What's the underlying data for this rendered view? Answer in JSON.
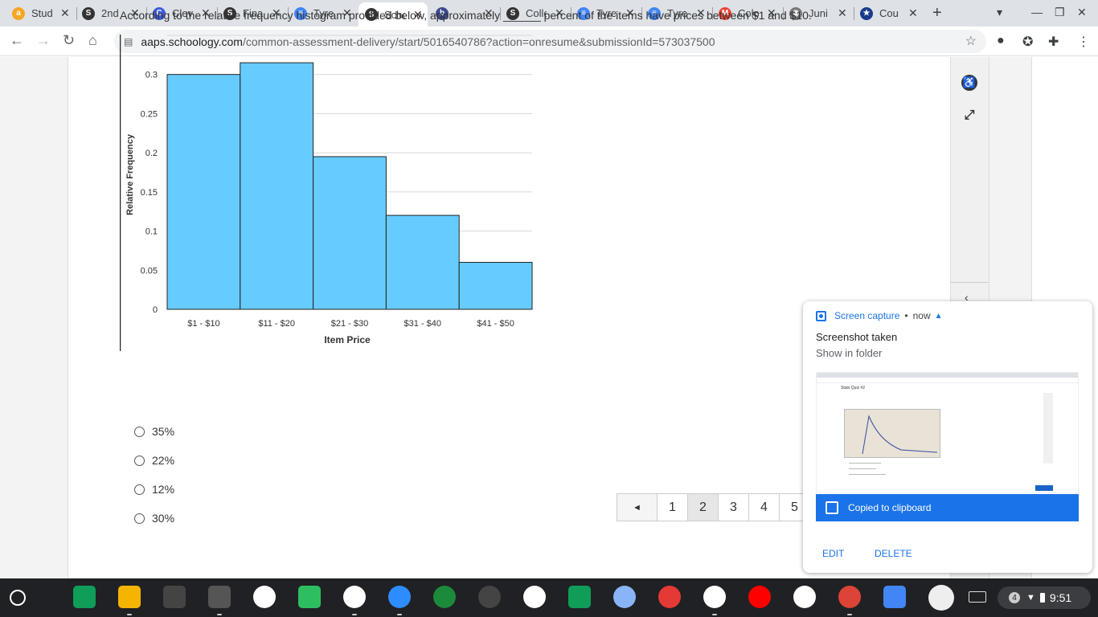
{
  "browser": {
    "tabs": [
      {
        "title": "Stud",
        "fav": "a",
        "color": "#f5a623",
        "active": false
      },
      {
        "title": "2nd",
        "fav": "S",
        "color": "#333333",
        "active": false
      },
      {
        "title": "Clev",
        "fav": "C",
        "color": "#3b5bdb",
        "active": false
      },
      {
        "title": "Fina",
        "fav": "S",
        "color": "#333333",
        "active": false
      },
      {
        "title": "Tyre",
        "fav": "≡",
        "color": "#4285f4",
        "active": false
      },
      {
        "title": "Scho",
        "fav": "S",
        "color": "#333333",
        "active": true
      },
      {
        "title": "",
        "fav": "b",
        "color": "#3a4a8c",
        "active": false
      },
      {
        "title": "Colle",
        "fav": "S",
        "color": "#333333",
        "active": false
      },
      {
        "title": "Tyre",
        "fav": "≡",
        "color": "#4285f4",
        "active": false
      },
      {
        "title": "Tyre",
        "fav": "≡",
        "color": "#4285f4",
        "active": false
      },
      {
        "title": "Colo",
        "fav": "M",
        "color": "#ea4335",
        "active": false
      },
      {
        "title": "Juni",
        "fav": "◉",
        "color": "#777777",
        "active": false
      },
      {
        "title": "Cou",
        "fav": "★",
        "color": "#1a3a8c",
        "active": false
      }
    ],
    "url_site": "aaps.schoology.com",
    "url_path": "/common-assessment-delivery/start/5016540786?action=onresume&submissionId=573037500"
  },
  "question": {
    "text": "According to the relative frequency histogram provided below, approximately ______ percent of the items have prices between $1 and $10."
  },
  "chart_data": {
    "type": "bar",
    "categories": [
      "$1 - $10",
      "$11 - $20",
      "$21 - $30",
      "$31 - $40",
      "$41 - $50"
    ],
    "values": [
      0.3,
      0.315,
      0.195,
      0.12,
      0.06
    ],
    "xlabel": "Item Price",
    "ylabel": "Relative Frequency",
    "ylim": [
      0,
      0.35
    ],
    "yticks": [
      0,
      0.05,
      0.1,
      0.15,
      0.2,
      0.25,
      0.3
    ],
    "ytick_labels": [
      "0",
      "0.05",
      "0.1",
      "0.15",
      "0.2",
      "0.25",
      "0.3"
    ],
    "bar_color": "#66ccff",
    "grid": true
  },
  "answers": [
    {
      "label": "35%"
    },
    {
      "label": "22%"
    },
    {
      "label": "12%"
    },
    {
      "label": "30%"
    }
  ],
  "pager": {
    "prev_symbol": "◄",
    "pages": [
      "1",
      "2",
      "3",
      "4",
      "5"
    ],
    "current": "2"
  },
  "notification": {
    "source": "Screen capture",
    "dot": "•",
    "time": "now",
    "title": "Screenshot taken",
    "subtitle": "Show in folder",
    "thumbnail_title": "Stats Quiz #2",
    "clipboard_text": "Copied to clipboard",
    "edit_label": "EDIT",
    "delete_label": "DELETE"
  },
  "shelf": {
    "notification_count": "4",
    "time": "9:51"
  }
}
